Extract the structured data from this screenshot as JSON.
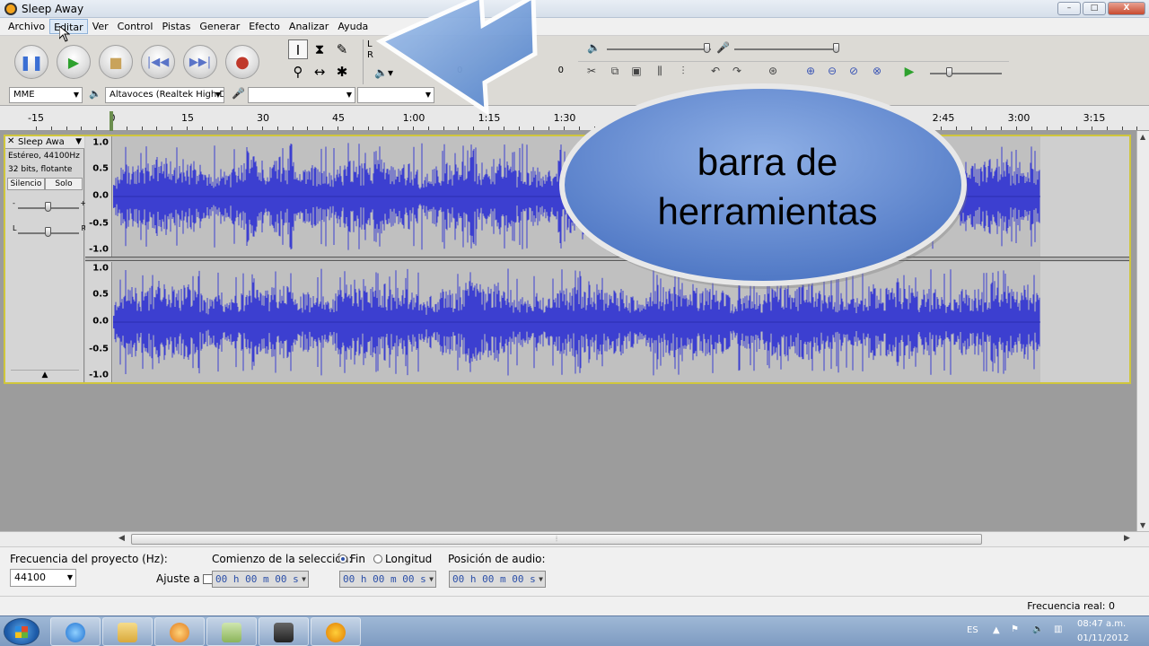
{
  "window": {
    "title": "Sleep Away",
    "controls": {
      "minimize": "–",
      "maximize": "□",
      "close": "X"
    }
  },
  "menu": [
    "Archivo",
    "Editar",
    "Ver",
    "Control",
    "Pistas",
    "Generar",
    "Efecto",
    "Analizar",
    "Ayuda"
  ],
  "meter": {
    "left_label": "L",
    "right_label": "R",
    "zero_a": "0",
    "zero_b": "0"
  },
  "device": {
    "host": "MME",
    "output": "Altavoces (Realtek High D",
    "input": "",
    "channels": ""
  },
  "ruler": {
    "labels": [
      "-15",
      "0",
      "15",
      "30",
      "45",
      "1:00",
      "1:15",
      "1:30",
      "2:45",
      "3:00",
      "3:15"
    ]
  },
  "track": {
    "name": "Sleep Awa",
    "info_rate": "Estéreo, 44100Hz",
    "info_format": "32 bits, flotante",
    "mute": "Silencio",
    "solo": "Solo",
    "pan_left": "L",
    "pan_right": "R",
    "gain_minus": "-",
    "gain_plus": "+",
    "scale": [
      "1.0",
      "0.5",
      "0.0",
      "-0.5",
      "-1.0"
    ]
  },
  "callout": {
    "line1": "barra de",
    "line2": "herramientas"
  },
  "selection": {
    "project_rate_label": "Frecuencia del proyecto (Hz):",
    "project_rate": "44100",
    "snap_label": "Ajuste a",
    "start_label": "Comienzo de la selección:",
    "end_option": "Fin",
    "length_option": "Longitud",
    "audio_pos_label": "Posición de audio:",
    "time_value": "00 h 00 m 00 s"
  },
  "status": {
    "actual_rate": "Frecuencia real: 0"
  },
  "taskbar": {
    "lang": "ES",
    "time": "08:47 a.m.",
    "date": "01/11/2012"
  },
  "colors": {
    "waveform": "#3c3fd0",
    "track_border": "#d0c63c",
    "callout_fill": "#6b8fd0"
  }
}
